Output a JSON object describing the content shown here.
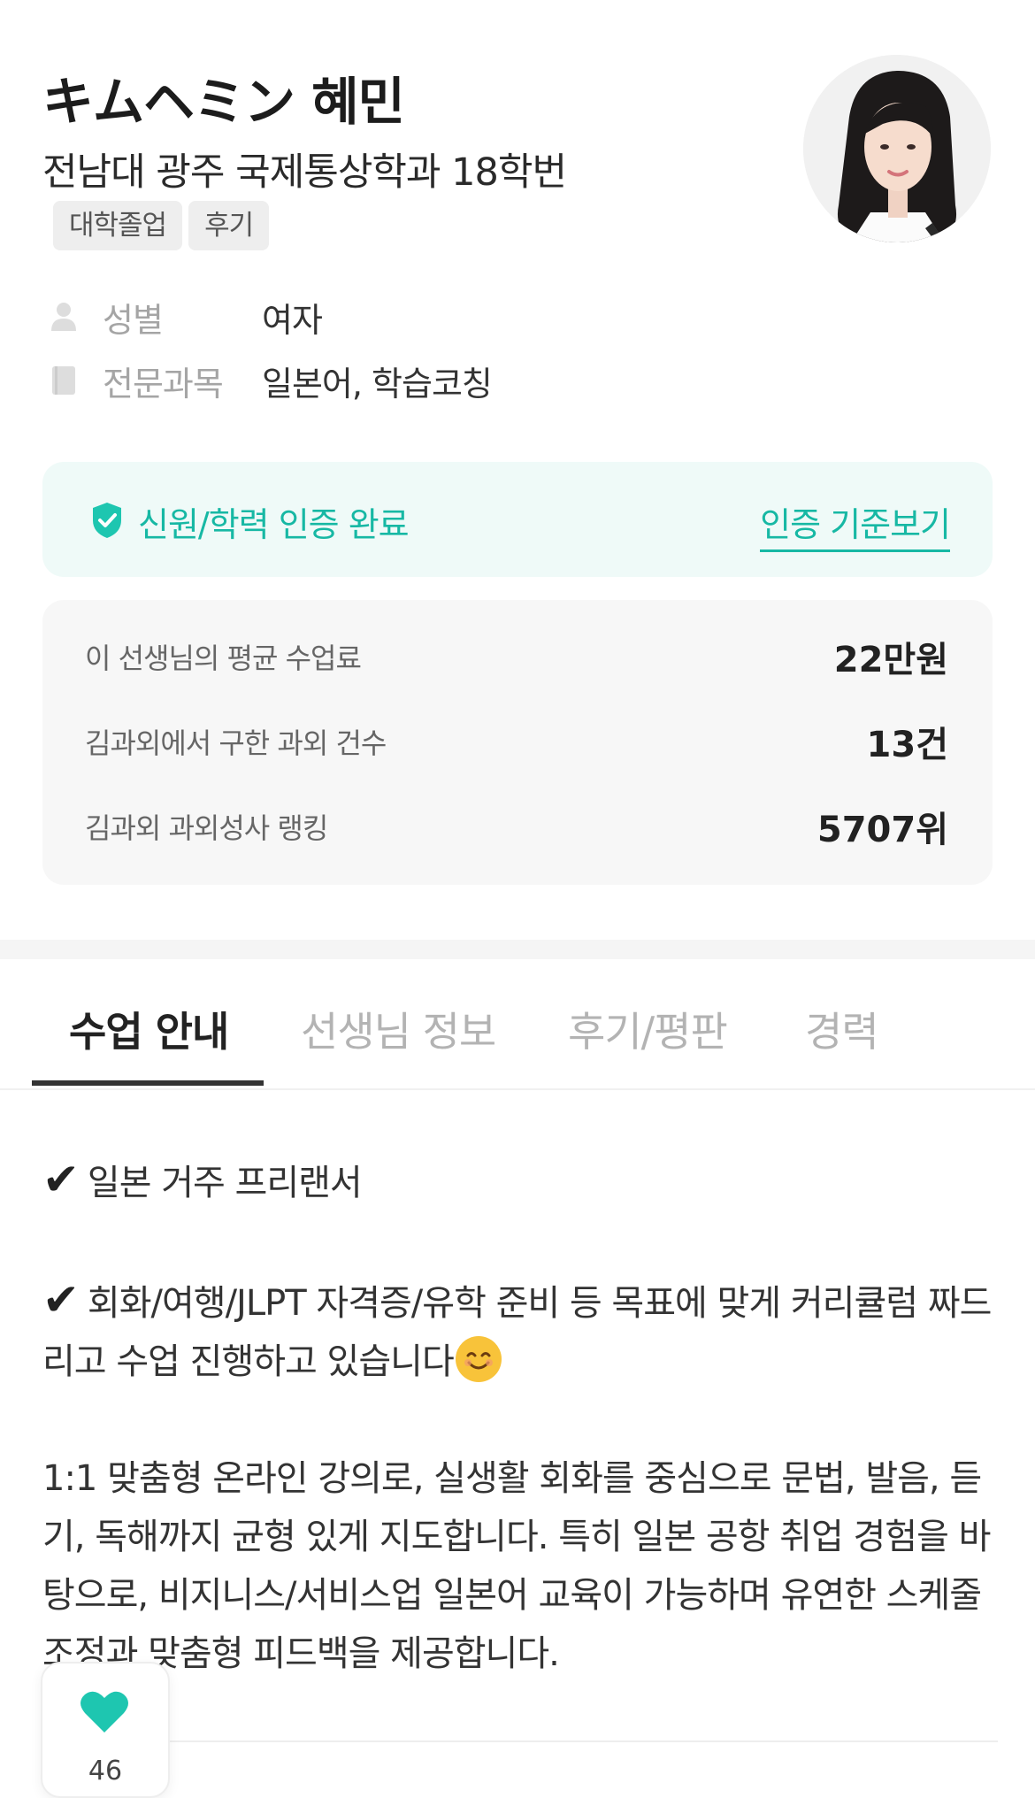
{
  "profile": {
    "name": "キムヘミン 혜민",
    "school": "전남대 광주 국제통상학과 18학번",
    "tags": [
      "대학졸업",
      "후기"
    ]
  },
  "info": {
    "gender_label": "성별",
    "gender_value": "여자",
    "subject_label": "전문과목",
    "subject_value": "일본어, 학습코칭"
  },
  "verification": {
    "status": "신원/학력 인증 완료",
    "link": "인증 기준보기"
  },
  "stats": [
    {
      "label": "이 선생님의 평균 수업료",
      "value": "22만원"
    },
    {
      "label": "김과외에서 구한 과외 건수",
      "value": "13건"
    },
    {
      "label": "김과외 과외성사 랭킹",
      "value": "5707위"
    }
  ],
  "tabs": [
    "수업 안내",
    "선생님 정보",
    "후기/평판",
    "경력"
  ],
  "content": {
    "line1": "일본 거주 프리랜서",
    "line2": "회화/여행/JLPT 자격증/유학 준비 등 목표에 맞게 커리큘럼 짜드리고 수업 진행하고 있습니다",
    "paragraph": "1:1 맞춤형 온라인 강의로, 실생활 회화를 중심으로 문법, 발음, 듣기, 독해까지 균형 있게 지도합니다. 특히 일본 공항 취업 경험을 바탕으로, 비지니스/서비스업 일본어 교육이 가능하며 유연한 스케줄 조정과 맞춤형 피드백을 제공합니다."
  },
  "like": {
    "count": "46"
  },
  "colors": {
    "accent": "#1ec6b0",
    "accent_text": "#17b8a4",
    "verify_bg": "#effaf8",
    "stats_bg": "#f7f7f7"
  },
  "icons": [
    "person-icon",
    "book-icon",
    "shield-check-icon",
    "heart-icon"
  ]
}
